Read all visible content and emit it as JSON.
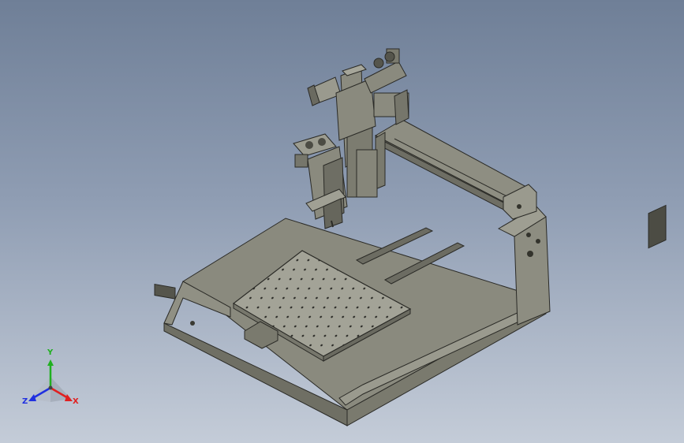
{
  "viewport": {
    "background_top": "#6f7f97",
    "background_bottom": "#c4ccd8",
    "model_color": "#858579",
    "edge_color": "#2a2a26"
  },
  "triad": {
    "x_label": "X",
    "y_label": "Y",
    "z_label": "Z",
    "x_color": "#e02020",
    "y_color": "#20b020",
    "z_color": "#2030e0"
  }
}
